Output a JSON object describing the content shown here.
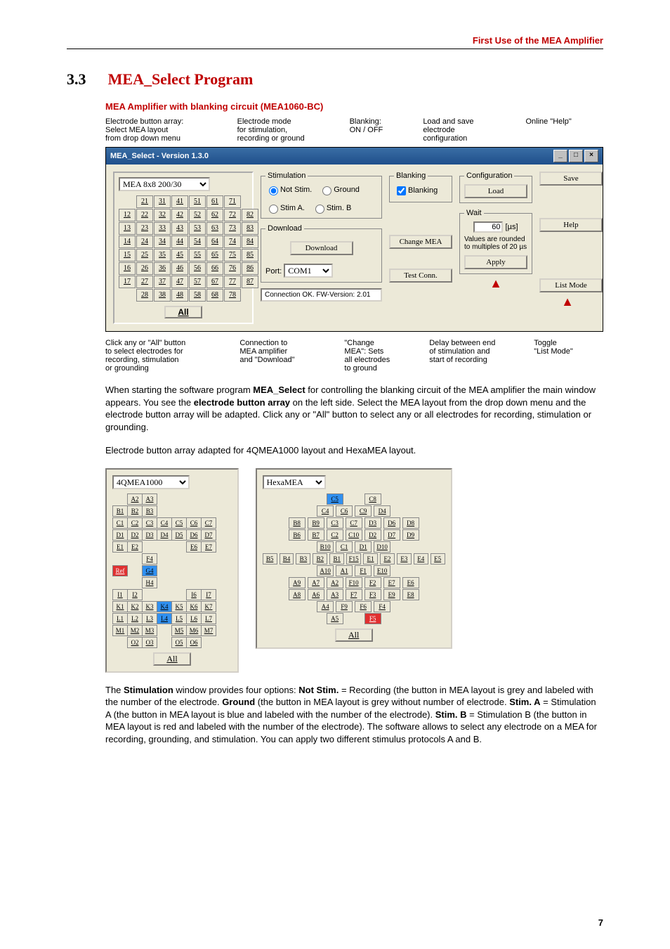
{
  "header": "First Use of the MEA Amplifier",
  "section": {
    "num": "3.3",
    "title": "MEA_Select Program"
  },
  "subtitle": "MEA Amplifier with blanking circuit (MEA1060-BC)",
  "annotations_top": {
    "a1": "Electrode button array:\nSelect MEA layout\nfrom drop down menu",
    "a2": "Electrode mode\nfor stimulation,\nrecording or ground",
    "a3": "Blanking:\nON / OFF",
    "a4": "Load and save\nelectrode\nconfiguration",
    "a5": "Online \"Help\""
  },
  "app": {
    "title": "MEA_Select  -  Version 1.3.0",
    "layout_selected": "MEA 8x8 200/30",
    "grid": [
      [
        "",
        "21",
        "31",
        "41",
        "51",
        "61",
        "71",
        ""
      ],
      [
        "12",
        "22",
        "32",
        "42",
        "52",
        "62",
        "72",
        "82"
      ],
      [
        "13",
        "23",
        "33",
        "43",
        "53",
        "63",
        "73",
        "83"
      ],
      [
        "14",
        "24",
        "34",
        "44",
        "54",
        "64",
        "74",
        "84"
      ],
      [
        "15",
        "25",
        "35",
        "45",
        "55",
        "65",
        "75",
        "85"
      ],
      [
        "16",
        "26",
        "36",
        "46",
        "56",
        "66",
        "76",
        "86"
      ],
      [
        "17",
        "27",
        "37",
        "47",
        "57",
        "67",
        "77",
        "87"
      ],
      [
        "",
        "28",
        "38",
        "48",
        "58",
        "68",
        "78",
        ""
      ]
    ],
    "all_label": "All",
    "stim": {
      "legend": "Stimulation",
      "not_stim": "Not Stim.",
      "ground": "Ground",
      "stim_a": "Stim A.",
      "stim_b": "Stim. B"
    },
    "download": {
      "legend": "Download",
      "button": "Download",
      "port_label": "Port:",
      "port_value": "COM1",
      "status": "Connection OK. FW-Version: 2.01"
    },
    "blanking": {
      "legend": "Blanking",
      "check": "Blanking",
      "change": "Change MEA",
      "test": "Test Conn."
    },
    "config": {
      "legend": "Configuration",
      "load": "Load",
      "save": "Save"
    },
    "wait": {
      "legend": "Wait",
      "value": "60",
      "unit": "[µs]",
      "note": "Values are rounded\nto multiples of 20 µs",
      "apply": "Apply"
    },
    "help": "Help",
    "list_mode": "List Mode"
  },
  "annotations_bottom": {
    "b1": "Click any or \"All\" button\nto select electrodes for\nrecording, stimulation\nor grounding",
    "b2": "Connection to\nMEA amplifier\nand \"Download\"",
    "b3": "\"Change\nMEA\": Sets\nall electrodes\nto ground",
    "b4": "Delay between end\nof stimulation and\nstart of recording",
    "b5": "Toggle\n\"List Mode\""
  },
  "para1": {
    "t1": "When starting the software program ",
    "b1": "MEA_Select",
    "t2": " for controlling the blanking circuit of the MEA amplifier the main window appears. You see the ",
    "b2": "electrode button array",
    "t3": " on the left side. Select the MEA layout from the drop down menu and the electrode button array will be adapted. Click any or \"All\" button to select any or all electrodes for recording, stimulation or grounding."
  },
  "para2": "Electrode button array adapted for 4QMEA1000 layout and HexaMEA layout.",
  "mini1": {
    "select": "4QMEA1000",
    "rows": [
      [
        "",
        "A2",
        "A3",
        "",
        "",
        "",
        "",
        ""
      ],
      [
        "B1",
        "B2",
        "B3",
        "",
        "",
        "",
        "",
        ""
      ],
      [
        "C1",
        "C2",
        "C3",
        "C4",
        "C5",
        "C6",
        "C7",
        ""
      ],
      [
        "D1",
        "D2",
        "D3",
        "D4",
        "D5",
        "D6",
        "D7",
        ""
      ],
      [
        "E1",
        "E2",
        "",
        "",
        "",
        "E6",
        "E7",
        ""
      ],
      [
        "",
        "",
        "F4",
        "",
        "",
        "",
        "",
        ""
      ],
      [
        "Ref",
        "",
        "G4",
        "",
        "",
        "",
        "",
        ""
      ],
      [
        "",
        "",
        "H4",
        "",
        "",
        "",
        "",
        ""
      ],
      [
        "I1",
        "I2",
        "",
        "",
        "",
        "I6",
        "I7",
        ""
      ],
      [
        "K1",
        "K2",
        "K3",
        "K4",
        "K5",
        "K6",
        "K7",
        ""
      ],
      [
        "L1",
        "L2",
        "L3",
        "L4",
        "L5",
        "L6",
        "L7",
        ""
      ],
      [
        "M1",
        "M2",
        "M3",
        "",
        "M5",
        "M6",
        "M7",
        ""
      ],
      [
        "",
        "O2",
        "O3",
        "",
        "O5",
        "O6",
        "",
        ""
      ]
    ],
    "special": {
      "Ref": "red",
      "G4": "blue",
      "K4": "blue",
      "L4": "blue"
    },
    "all": "All"
  },
  "mini2": {
    "select": "HexaMEA",
    "rows": [
      [
        "C5",
        "",
        "C8"
      ],
      [
        "C4",
        "C6",
        "C9",
        "D4"
      ],
      [
        "B8",
        "B9",
        "C3",
        "C7",
        "D3",
        "D6",
        "D8"
      ],
      [
        "B6",
        "B7",
        "C2",
        "C10",
        "D2",
        "D7",
        "D9"
      ],
      [
        "B10",
        "C1",
        "D1",
        "D10"
      ],
      [
        "B5",
        "B4",
        "B3",
        "B2",
        "B1",
        "F15",
        "E1",
        "E2",
        "E3",
        "E4",
        "E5"
      ],
      [
        "A10",
        "A1",
        "F1",
        "E10"
      ],
      [
        "A9",
        "A7",
        "A2",
        "F10",
        "F2",
        "E7",
        "E6"
      ],
      [
        "A8",
        "A6",
        "A3",
        "F7",
        "F3",
        "E9",
        "E8"
      ],
      [
        "A4",
        "F9",
        "F6",
        "F4"
      ],
      [
        "A5",
        "",
        "F5"
      ]
    ],
    "special": {
      "C5": "blue",
      "F5": "red"
    },
    "all": "All"
  },
  "para3": {
    "t1": "The ",
    "b1": "Stimulation",
    "t2": " window provides four options: ",
    "b2": "Not Stim.",
    "t3": " = Recording (the button in MEA layout is grey and labeled with the number of the electrode. ",
    "b3": "Ground",
    "t4": " (the button in MEA layout is grey without number of electrode. ",
    "b4": "Stim. A",
    "t5": " = Stimulation A (the button in MEA layout is blue and labeled with the number of the electrode). ",
    "b5": "Stim. B",
    "t6": " = Stimulation B (the button in MEA layout is red and labeled with the number of the electrode). The software allows to select any electrode on a MEA for recording, grounding, and stimulation. You can apply two different stimulus protocols A and B."
  },
  "page_number": "7"
}
